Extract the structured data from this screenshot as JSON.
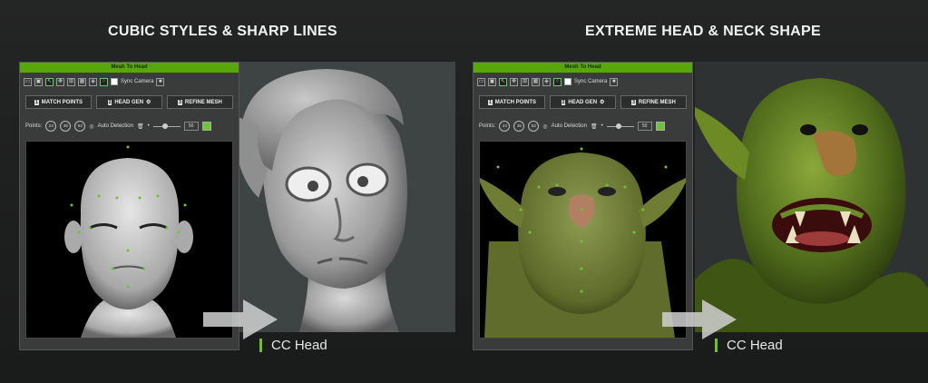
{
  "left": {
    "heading": "CUBIC STYLES & SHARP LINES",
    "panel": {
      "title": "Mesh To Head",
      "sync_label": "Sync Camera",
      "tabs": [
        {
          "num": "1",
          "label": "MATCH POINTS"
        },
        {
          "num": "2",
          "label": "HEAD GEN"
        },
        {
          "num": "3",
          "label": "REFINE MESH"
        }
      ],
      "points_label": "Points:",
      "point_badges": [
        "24",
        "35",
        "52"
      ],
      "auto_detection": "Auto Detection",
      "slider_value": "50",
      "pt_color": "#6dc43a"
    },
    "result_label": "CC Head"
  },
  "right": {
    "heading": "EXTREME HEAD & NECK SHAPE",
    "panel": {
      "title": "Mesh To Head",
      "sync_label": "Sync Camera",
      "tabs": [
        {
          "num": "1",
          "label": "MATCH POINTS"
        },
        {
          "num": "2",
          "label": "HEAD GEN"
        },
        {
          "num": "3",
          "label": "REFINE MESH"
        }
      ],
      "points_label": "Points:",
      "point_badges": [
        "24",
        "35",
        "52"
      ],
      "auto_detection": "Auto Detection",
      "slider_value": "50",
      "pt_color": "#6dc43a"
    },
    "result_label": "CC Head"
  },
  "colors": {
    "accent": "#57a70a",
    "bar": "#6fc32a",
    "background": "#1e1f1f"
  }
}
